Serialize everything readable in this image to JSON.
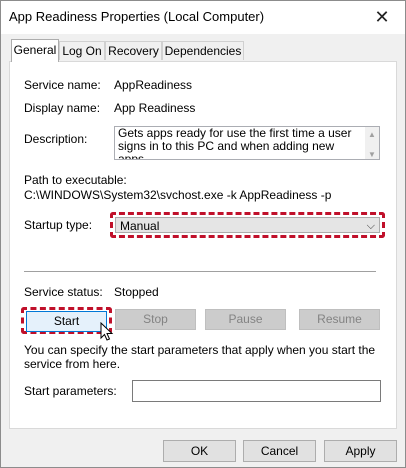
{
  "window": {
    "title": "App Readiness Properties (Local Computer)"
  },
  "icons": {
    "close": "close-icon",
    "chevron": "chevron-down-icon",
    "cursor": "mouse-pointer-icon"
  },
  "tabs": [
    {
      "label": "General",
      "active": true
    },
    {
      "label": "Log On",
      "active": false
    },
    {
      "label": "Recovery",
      "active": false
    },
    {
      "label": "Dependencies",
      "active": false
    }
  ],
  "general": {
    "service_name_label": "Service name:",
    "service_name": "AppReadiness",
    "display_name_label": "Display name:",
    "display_name": "App Readiness",
    "description_label": "Description:",
    "description": "Gets apps ready for use the first time a user signs in to this PC and when adding new apps.",
    "path_label": "Path to executable:",
    "path": "C:\\WINDOWS\\System32\\svchost.exe -k AppReadiness -p",
    "startup_type_label": "Startup type:",
    "startup_type": "Manual",
    "service_status_label": "Service status:",
    "service_status": "Stopped",
    "buttons": {
      "start": "Start",
      "stop": "Stop",
      "pause": "Pause",
      "resume": "Resume"
    },
    "hint": "You can specify the start parameters that apply when you start the service from here.",
    "start_params_label": "Start parameters:",
    "start_params_value": ""
  },
  "footer": {
    "ok": "OK",
    "cancel": "Cancel",
    "apply": "Apply"
  },
  "colors": {
    "highlight": "#c0102a",
    "focus": "#0078d7"
  }
}
